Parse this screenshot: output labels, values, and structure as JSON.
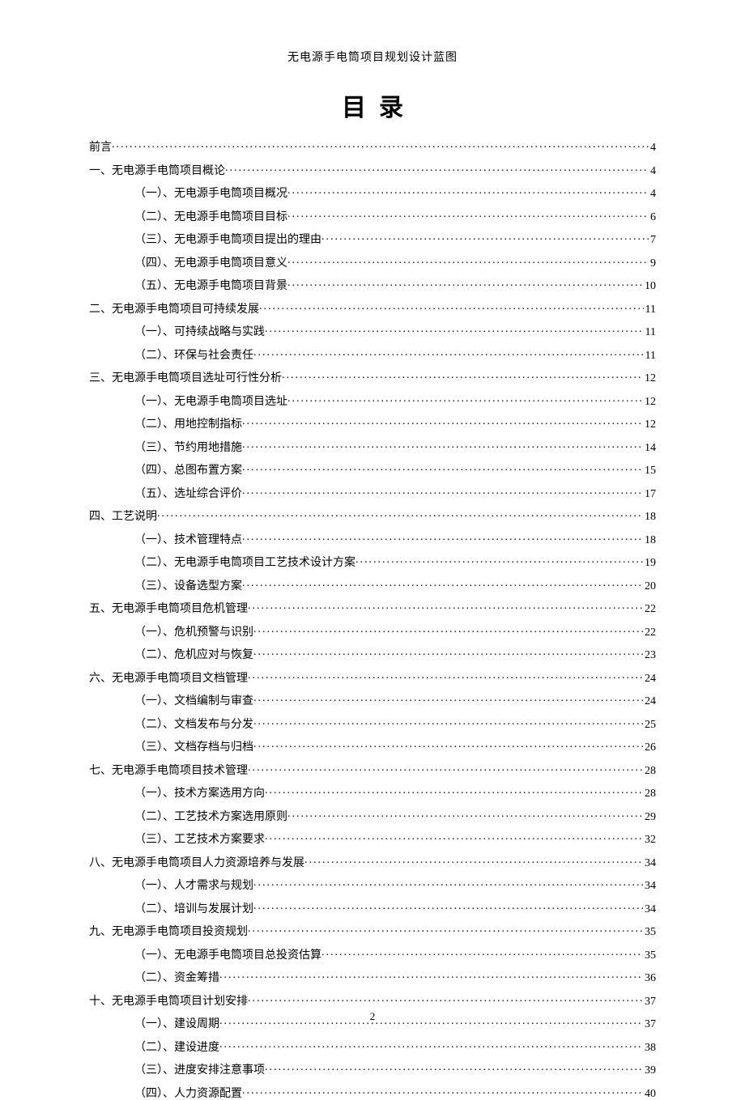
{
  "header": "无电源手电筒项目规划设计蓝图",
  "title": "目录",
  "page_number": "2",
  "toc": [
    {
      "level": 0,
      "label": "前言",
      "page": "4"
    },
    {
      "level": 0,
      "label": "一、无电源手电筒项目概论",
      "page": "4"
    },
    {
      "level": 1,
      "label": "（一）、无电源手电筒项目概况",
      "page": "4"
    },
    {
      "level": 1,
      "label": "（二）、无电源手电筒项目目标",
      "page": "6"
    },
    {
      "level": 1,
      "label": "（三）、无电源手电筒项目提出的理由",
      "page": "7"
    },
    {
      "level": 1,
      "label": "（四）、无电源手电筒项目意义",
      "page": "9"
    },
    {
      "level": 1,
      "label": "（五）、无电源手电筒项目背景",
      "page": "10"
    },
    {
      "level": 0,
      "label": "二、无电源手电筒项目可持续发展",
      "page": "11"
    },
    {
      "level": 1,
      "label": "（一）、可持续战略与实践",
      "page": "11"
    },
    {
      "level": 1,
      "label": "（二）、环保与社会责任",
      "page": "11"
    },
    {
      "level": 0,
      "label": "三、无电源手电筒项目选址可行性分析",
      "page": "12"
    },
    {
      "level": 1,
      "label": "（一）、无电源手电筒项目选址",
      "page": "12"
    },
    {
      "level": 1,
      "label": "（二）、用地控制指标",
      "page": "12"
    },
    {
      "level": 1,
      "label": "（三）、节约用地措施",
      "page": "14"
    },
    {
      "level": 1,
      "label": "（四）、总图布置方案",
      "page": "15"
    },
    {
      "level": 1,
      "label": "（五）、选址综合评价",
      "page": "17"
    },
    {
      "level": 0,
      "label": "四、工艺说明",
      "page": "18"
    },
    {
      "level": 1,
      "label": "（一）、技术管理特点",
      "page": "18"
    },
    {
      "level": 1,
      "label": "（二）、无电源手电筒项目工艺技术设计方案",
      "page": "19"
    },
    {
      "level": 1,
      "label": "（三）、设备选型方案",
      "page": "20"
    },
    {
      "level": 0,
      "label": "五、无电源手电筒项目危机管理",
      "page": "22"
    },
    {
      "level": 1,
      "label": "（一）、危机预警与识别",
      "page": "22"
    },
    {
      "level": 1,
      "label": "（二）、危机应对与恢复",
      "page": "23"
    },
    {
      "level": 0,
      "label": "六、无电源手电筒项目文档管理",
      "page": "24"
    },
    {
      "level": 1,
      "label": "（一）、文档编制与审查",
      "page": "24"
    },
    {
      "level": 1,
      "label": "（二）、文档发布与分发",
      "page": "25"
    },
    {
      "level": 1,
      "label": "（三）、文档存档与归档",
      "page": "26"
    },
    {
      "level": 0,
      "label": "七、无电源手电筒项目技术管理",
      "page": "28"
    },
    {
      "level": 1,
      "label": "（一）、技术方案选用方向",
      "page": "28"
    },
    {
      "level": 1,
      "label": "（二）、工艺技术方案选用原则",
      "page": "29"
    },
    {
      "level": 1,
      "label": "（三）、工艺技术方案要求",
      "page": "32"
    },
    {
      "level": 0,
      "label": "八、无电源手电筒项目人力资源培养与发展",
      "page": "34"
    },
    {
      "level": 1,
      "label": "（一）、人才需求与规划",
      "page": "34"
    },
    {
      "level": 1,
      "label": "（二）、培训与发展计划",
      "page": "34"
    },
    {
      "level": 0,
      "label": "九、无电源手电筒项目投资规划",
      "page": "35"
    },
    {
      "level": 1,
      "label": "（一）、无电源手电筒项目总投资估算",
      "page": "35"
    },
    {
      "level": 1,
      "label": "（二）、资金筹措",
      "page": "36"
    },
    {
      "level": 0,
      "label": "十、无电源手电筒项目计划安排",
      "page": "37"
    },
    {
      "level": 1,
      "label": "（一）、建设周期",
      "page": "37"
    },
    {
      "level": 1,
      "label": "（二）、建设进度",
      "page": "38"
    },
    {
      "level": 1,
      "label": "（三）、进度安排注意事项",
      "page": "39"
    },
    {
      "level": 1,
      "label": "（四）、人力资源配置",
      "page": "40"
    }
  ]
}
